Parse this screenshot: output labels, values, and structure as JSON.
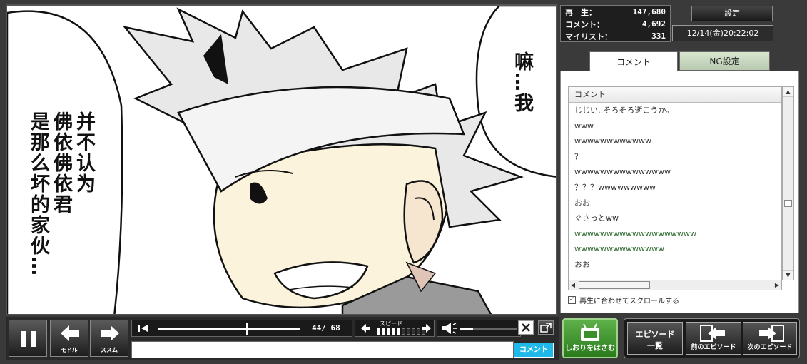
{
  "viewer": {
    "dialogue_left_col1": "并不认为",
    "dialogue_left_col2": "佛依佛依君",
    "dialogue_left_col3": "是那么坏的家伙…",
    "dialogue_right": "嘛…我"
  },
  "stats": {
    "play_label": "再　生：",
    "play_value": "147,680",
    "comment_label": "コメント：",
    "comment_value": "4,692",
    "mylist_label": "マイリスト：",
    "mylist_value": "331"
  },
  "settings_label": "設定",
  "datetime": "12/14(金)20:22:02",
  "tabs": {
    "comment": "コメント",
    "ng": "NG設定"
  },
  "comment_panel": {
    "header": "コメント",
    "items": [
      {
        "text": "じじい‥そろそろ逝こうか。",
        "color": "#333333"
      },
      {
        "text": "www",
        "color": "#333333"
      },
      {
        "text": "wwwwwwwwwwww",
        "color": "#333333"
      },
      {
        "text": "？",
        "color": "#333333"
      },
      {
        "text": "wwwwwwwwwwwwwww",
        "color": "#333333"
      },
      {
        "text": "？？？wwwwwwwww",
        "color": "#333333"
      },
      {
        "text": "おお",
        "color": "#333333"
      },
      {
        "text": "ぐさっとww",
        "color": "#333333"
      },
      {
        "text": "wwwwwwwwwwwwwwwwwww",
        "color": "#2e6b2e"
      },
      {
        "text": "wwwwwwwwwwwwww",
        "color": "#2e6b2e"
      },
      {
        "text": "おお",
        "color": "#333333"
      }
    ],
    "scroll_sync_label": "再生に合わせてスクロールする"
  },
  "controls": {
    "back_label": "モドル",
    "forward_label": "ススム",
    "time": "44/ 68",
    "speed_label": "スピード",
    "speed_level": 5,
    "speed_max": 10,
    "comment_submit": "コメント"
  },
  "bottom_buttons": {
    "bookmark": "しおりをはさむ",
    "episode_list_line1": "エピソード",
    "episode_list_line2": "一覧",
    "prev_episode": "前のエピソード",
    "next_episode": "次のエピソード"
  }
}
